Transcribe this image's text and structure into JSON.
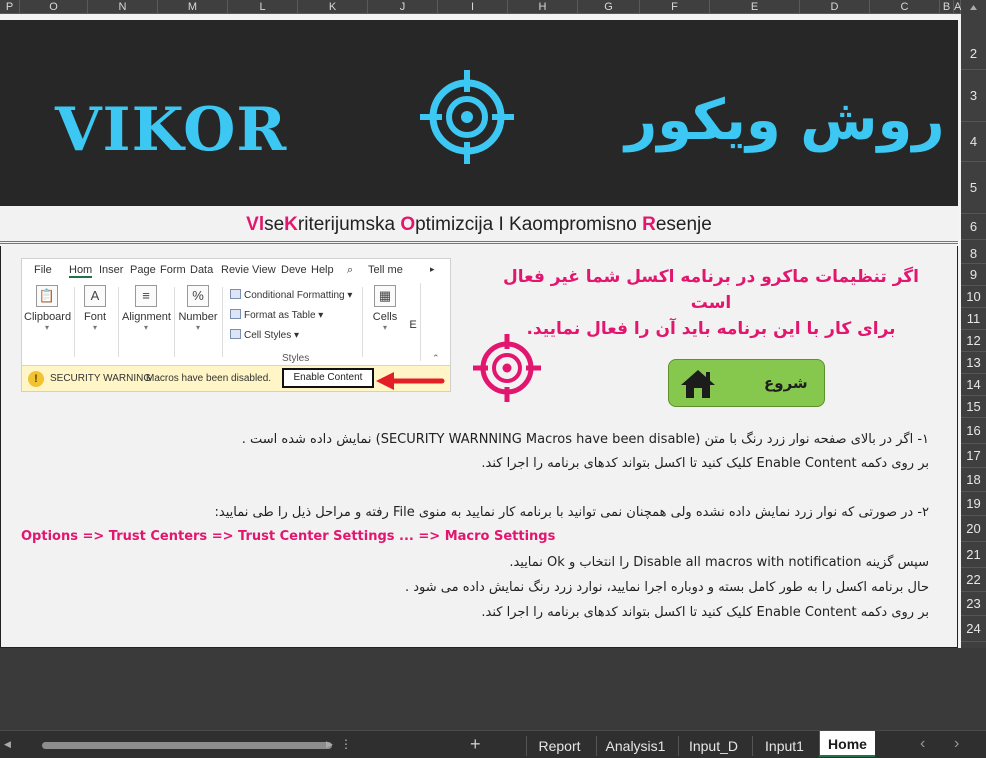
{
  "columns": [
    "P",
    "O",
    "N",
    "M",
    "L",
    "K",
    "J",
    "I",
    "H",
    "G",
    "F",
    "E",
    "D",
    "C",
    "B",
    "A"
  ],
  "rows": [
    "2",
    "3",
    "4",
    "5",
    "6",
    "8",
    "9",
    "10",
    "11",
    "12",
    "13",
    "14",
    "15",
    "16",
    "17",
    "18",
    "19",
    "20",
    "21",
    "22",
    "23",
    "24"
  ],
  "banner": {
    "title_en": "VIKOR",
    "title_fa": "روش ویکور",
    "subtitle_parts": [
      {
        "text": "Vl",
        "highlight": true
      },
      {
        "text": "se",
        "highlight": false
      },
      {
        "text": "K",
        "highlight": true
      },
      {
        "text": "riterijumska ",
        "highlight": false
      },
      {
        "text": "O",
        "highlight": true
      },
      {
        "text": "ptimizcija I Kaompromisno ",
        "highlight": false
      },
      {
        "text": "R",
        "highlight": true
      },
      {
        "text": "esenje",
        "highlight": false
      }
    ]
  },
  "ribbon": {
    "tabs": [
      "File",
      "Hom",
      "Inser",
      "Page",
      "Form",
      "Data",
      "Revie",
      "View",
      "Deve",
      "Help",
      "Tell me"
    ],
    "groups": {
      "clipboard": "Clipboard",
      "font": "Font",
      "alignment": "Alignment",
      "number": "Number",
      "cells": "Cells",
      "editing": "E"
    },
    "styles_items": [
      "Conditional Formatting",
      "Format as Table",
      "Cell Styles"
    ],
    "styles_label": "Styles",
    "security_title": "SECURITY WARNING",
    "security_message": "Macros have been disabled.",
    "enable_button": "Enable Content"
  },
  "notice": {
    "line1": "اگر تنظیمات ماکرو در برنامه اکسل شما غیر فعال",
    "line2": "است",
    "line3": "برای کار با این برنامه باید آن را فعال نمایید."
  },
  "start_button": "شروع",
  "instructions": {
    "l1": "۱- اگر در بالای صفحه نوار زرد رنگ با متن (SECURITY WARNNING Macros have been disable) نمایش داده شده است .",
    "l2": "بر روی دکمه Enable Content  کلیک کنید تا اکسل بتواند کدهای برنامه را اجرا کند.",
    "l3": "۲- در صورتی که نوار زرد نمایش داده نشده ولی همچنان نمی توانید با برنامه کار نمایید به منوی File رفته و مراحل ذیل را طی نمایید:",
    "path": "Options  =>  Trust Centers   =>   Trust Center Settings   ...   =>   Macro Settings",
    "l4": "سپس گزینه Disable all macros with notification را انتخاب و Ok نمایید.",
    "l5": "حال برنامه اکسل را به طور کامل بسته و دوباره اجرا نمایید، نوارد زرد رنگ نمایش داده می شود .",
    "l6": "بر روی دکمه Enable Content  کلیک کنید تا اکسل بتواند کدهای برنامه را اجرا کند."
  },
  "sheet_tabs": [
    "Report",
    "Analysis1",
    "Input_D",
    "Input1",
    "Home"
  ],
  "active_tab": "Home",
  "colors": {
    "accent_cyan": "#3cc8f2",
    "accent_pink": "#e2166e",
    "start_green": "#86c84d",
    "banner_bg": "#272727"
  }
}
